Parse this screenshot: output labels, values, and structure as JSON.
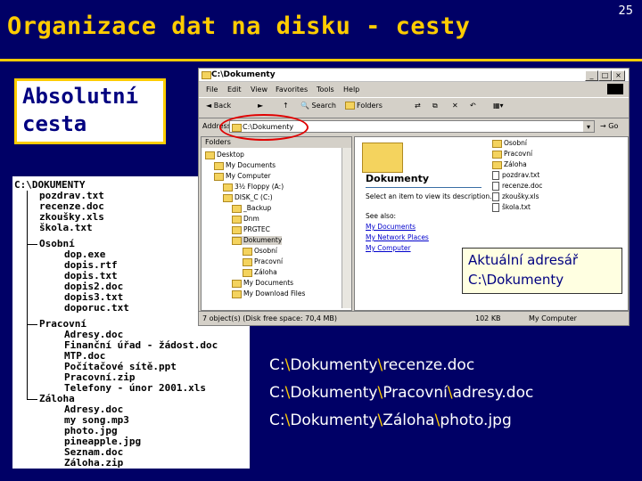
{
  "slide": {
    "title": "Organizace dat na disku - cesty",
    "page_number": "25",
    "absolute_label_line1": "Absolutní",
    "absolute_label_line2": "cesta",
    "current_dir_line1": "Aktuální adresář",
    "current_dir_line2": "C:\\Dokumenty",
    "colors": {
      "background": "#000066",
      "title": "#ffcc00",
      "highlight_oval": "#e00000"
    }
  },
  "tree": {
    "root": "C:\\DOKUMENTY",
    "root_files": [
      "pozdrav.txt",
      "recenze.doc",
      "zkoušky.xls",
      "škola.txt"
    ],
    "folders": [
      {
        "name": "Osobní",
        "files": [
          "dop.exe",
          "dopis.rtf",
          "dopis.txt",
          "dopis2.doc",
          "dopis3.txt",
          "doporuc.txt"
        ]
      },
      {
        "name": "Pracovní",
        "files": [
          "Adresy.doc",
          "Finanční úřad - žádost.doc",
          "MTP.doc",
          "Počítačové sítě.ppt",
          "Pracovní.zip",
          "Telefony - únor 2001.xls"
        ]
      },
      {
        "name": "Záloha",
        "files": [
          "Adresy.doc",
          "my song.mp3",
          "photo.jpg",
          "pineapple.jpg",
          "Seznam.doc",
          "Záloha.zip"
        ]
      }
    ]
  },
  "explorer": {
    "window_title": "C:\\Dokumenty",
    "menu": [
      "File",
      "Edit",
      "View",
      "Favorites",
      "Tools",
      "Help"
    ],
    "toolbar": {
      "back": "Back",
      "search": "Search",
      "folders": "Folders"
    },
    "address_label": "Address",
    "address_value": "C:\\Dokumenty",
    "go_label": "Go",
    "folders_header": "Folders",
    "folder_tree": [
      "Desktop",
      "My Documents",
      "My Computer",
      "3½ Floppy (A:)",
      "DISK_C (C:)",
      "_Backup",
      "Dnm",
      "PRGTEC",
      "Dokumenty",
      "Osobní",
      "Pracovní",
      "Záloha",
      "My Documents",
      "My Download Files"
    ],
    "info_title": "Dokumenty",
    "info_text": "Select an item to view its description.",
    "see_also": "See also:",
    "links": [
      "My Documents",
      "My Network Places",
      "My Computer"
    ],
    "files": [
      "Osobní",
      "Pracovní",
      "Záloha",
      "pozdrav.txt",
      "recenze.doc",
      "zkoušky.xls",
      "škola.txt"
    ],
    "status_left": "7 object(s) (Disk free space: 70,4 MB)",
    "status_mid": "102 KB",
    "status_right": "My Computer",
    "win_buttons": [
      "_",
      "□",
      "×"
    ]
  },
  "paths": [
    {
      "p1": "C:",
      "p2": "Dokumenty",
      "p3": "recenze.doc"
    },
    {
      "p1": "C:",
      "p2": "Dokumenty",
      "p3": "Pracovní",
      "p4": "adresy.doc"
    },
    {
      "p1": "C:",
      "p2": "Dokumenty",
      "p3": "Záloha",
      "p4": "photo.jpg"
    }
  ]
}
